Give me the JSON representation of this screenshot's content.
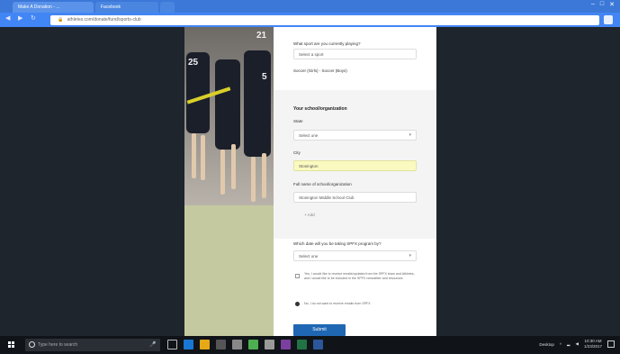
{
  "browser": {
    "tabs": [
      "Make A Donation - ...",
      "Facebook"
    ],
    "url": "athletes.com/donate/fund/sports-club",
    "win_controls": [
      "–",
      "□",
      "✕"
    ]
  },
  "form": {
    "q_sport": "What sport are you currently playing?",
    "sport_placeholder": "Select a sport",
    "sport_value": "Soccer (Girls) - Soccer (Boys)",
    "school_heading": "Your school/organization",
    "state_label": "State",
    "state_placeholder": "Select one",
    "city_label": "City",
    "city_value": "Stonington",
    "fullname_label": "Full name of school/organization",
    "fullname_value": "Stonington Middle School Club",
    "add_label": "+ Add",
    "q_date": "Which date will you be taking SPFX program by?",
    "date_placeholder": "Select one",
    "consent_text": "Yes, I would like to receive emails/updates from the SPFX team and Athletes, and I would like to be included in the SPFX newsletter and resources.",
    "radio_text": "No, I do not want to receive emails from SPFX",
    "submit_label": "Submit"
  },
  "photo": {
    "jersey_numbers": [
      "25",
      "21",
      "5"
    ]
  },
  "taskbar": {
    "search_placeholder": "Type here to search",
    "tray_text": "Desktop",
    "time": "10:30 AM",
    "date": "1/23/2017"
  },
  "colors": {
    "chrome_blue": "#4285f4",
    "submit_blue": "#1f67b3",
    "highlight_yellow": "#fafac0",
    "page_bg": "#1e252d",
    "field_green": "#c5c9a0"
  }
}
